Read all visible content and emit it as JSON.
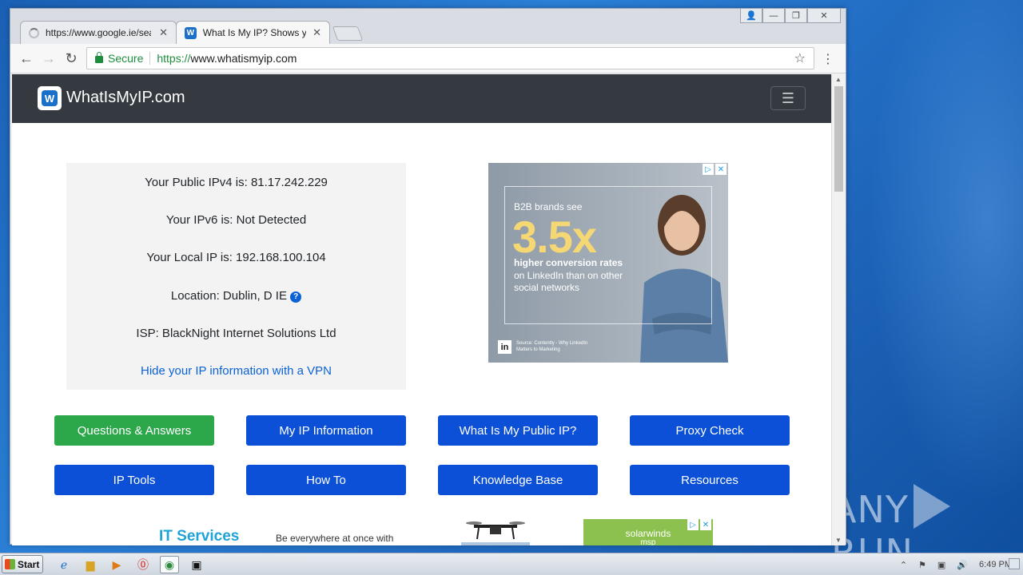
{
  "browser": {
    "tabs": [
      {
        "title": "https://www.google.ie/sear",
        "close": "✕",
        "loading": true
      },
      {
        "title": "What Is My IP? Shows your",
        "close": "✕",
        "active": true
      }
    ],
    "window_controls": [
      "👤",
      "—",
      "❐",
      "✕"
    ],
    "omnibox": {
      "secure_label": "Secure",
      "scheme": "https://",
      "host": "www.whatismyip.com"
    },
    "nav": {
      "back": "←",
      "forward": "→",
      "reload": "↻",
      "star": "☆",
      "menu": "⋮"
    }
  },
  "site": {
    "brand": "WhatIsMyIP.com",
    "logo_letter": "W",
    "menu_icon": "☰",
    "ip_info": {
      "ipv4": "Your Public IPv4 is: 81.17.242.229",
      "ipv6": "Your IPv6 is: Not Detected",
      "local_ip": "Your Local IP is: 192.168.100.104",
      "location": "Location: Dublin, D IE",
      "help": "?",
      "isp": "ISP: BlackNight Internet Solutions Ltd",
      "vpn_link": "Hide your IP information with a VPN"
    },
    "ad": {
      "line1": "B2B brands see",
      "big": "3.5x",
      "line2": "higher conversion rates",
      "line3": "on LinkedIn than on other social networks",
      "linkedin": "in",
      "source": "Source: Contently - Why LinkedIn Matters to Marketing",
      "adchoices": [
        "▷",
        "✕"
      ]
    },
    "buttons": {
      "qa": "Questions & Answers",
      "my_ip_info": "My IP Information",
      "public_ip": "What Is My Public IP?",
      "proxy_check": "Proxy Check",
      "ip_tools": "IP Tools",
      "how_to": "How To",
      "knowledge_base": "Knowledge Base",
      "resources": "Resources"
    },
    "bottom_ads": {
      "it_services": "IT Services",
      "be_everywhere": "Be everywhere at once with",
      "solarwinds": "solarwinds",
      "msp": "msp",
      "adchoices": [
        "▷",
        "✕"
      ]
    }
  },
  "taskbar": {
    "start": "Start",
    "clock": "6:49 PM",
    "tray_icons": [
      "⌃",
      "⚑",
      "▣",
      "🔊"
    ]
  },
  "watermark": {
    "left": "ANY",
    "right": "RUN"
  }
}
